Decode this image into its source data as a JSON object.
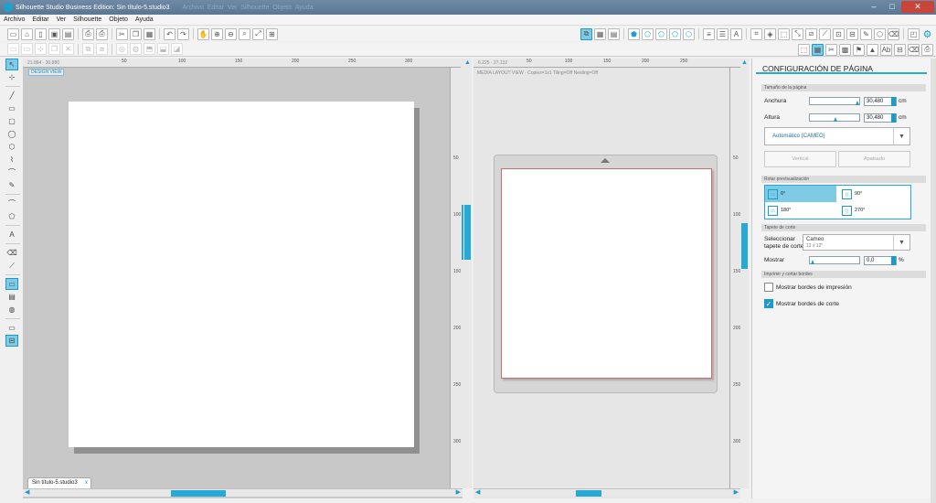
{
  "window": {
    "title": "Silhouette Studio Business Edition: Sin título-5.studio3",
    "ghost_menu": [
      "Archivo",
      "Editar",
      "Ver",
      "Silhouette",
      "Objeto",
      "Ayuda"
    ]
  },
  "menu": [
    "Archivo",
    "Editar",
    "Ver",
    "Silhouette",
    "Objeto",
    "Ayuda"
  ],
  "design_view": {
    "badge": "DESIGN VIEW",
    "coords": "21.864 · 30.880",
    "ruler_top": [
      "50",
      "100",
      "150",
      "200",
      "250",
      "300"
    ],
    "ruler_right": [
      "50",
      "100",
      "150",
      "200",
      "250",
      "300"
    ],
    "document_tab": "Sin título-5.studio3"
  },
  "media_view": {
    "coords": "6.225 · 27.132",
    "label": "MEDIA LAYOUT VIEW · Copies=1x1 Tiling=Off Nesting=Off",
    "ruler_top": [
      "50",
      "100",
      "150",
      "200",
      "250"
    ],
    "ruler_right": [
      "50",
      "100",
      "150",
      "200",
      "250",
      "300"
    ]
  },
  "panel": {
    "title": "CONFIGURACIÓN DE PÁGINA",
    "page_size": {
      "section": "Tamaño de la página",
      "width_label": "Anchura",
      "width_value": "30,480",
      "height_label": "Altura",
      "height_value": "30,480",
      "unit": "cm",
      "preset": "Automático (CAMEO)",
      "portrait": "Vertical",
      "landscape": "Apaisado"
    },
    "rotate": {
      "section": "Rotar previsualización",
      "options": [
        "0°",
        "90°",
        "180°",
        "270°"
      ],
      "selected": "0°"
    },
    "cutting_mat": {
      "section": "Tapete de corte",
      "select_label": "Seleccionar tapete de corte",
      "mat_name": "Cameo",
      "mat_size": "12 x 12\"",
      "show_label": "Mostrar",
      "show_value": "0,0",
      "show_unit": "%"
    },
    "borders": {
      "section": "Imprimir y cortar bordes",
      "print_borders": "Mostrar bordes de impresión",
      "print_checked": false,
      "cut_borders": "Mostrar bordes de corte",
      "cut_checked": true
    }
  },
  "colors": {
    "accent": "#27a9d8",
    "titlebar": "#5f7b96",
    "canvas_bg": "#c8c8c8"
  }
}
